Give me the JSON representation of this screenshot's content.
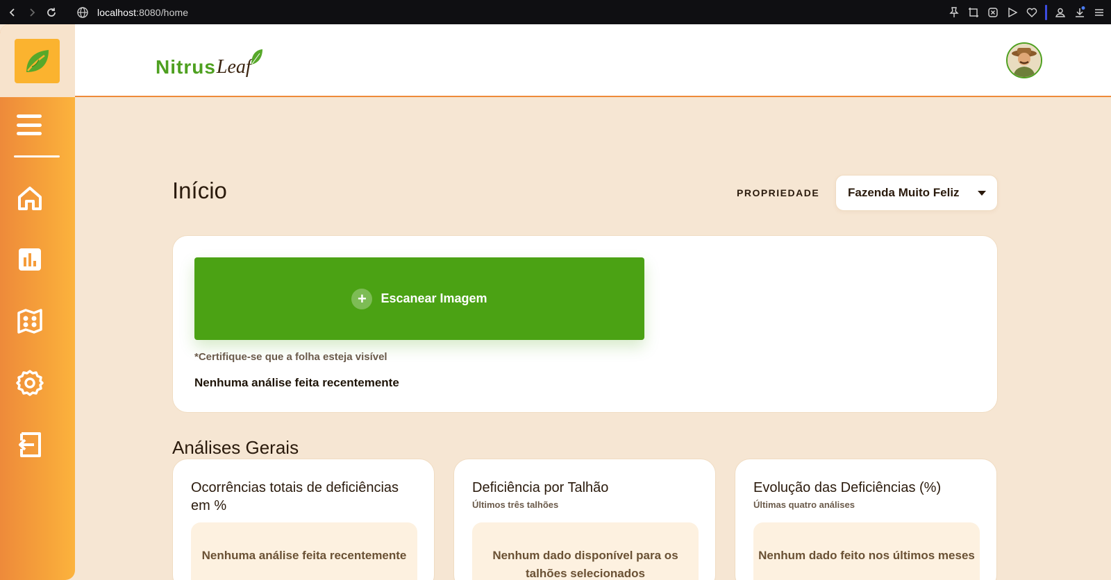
{
  "browser": {
    "url_host": "localhost",
    "url_rest": ":8080/home",
    "extension_icons": [
      "pin-icon",
      "screenshot-icon",
      "close-box-icon",
      "play-icon",
      "heart-icon",
      "profile-icon",
      "download-icon",
      "menu-icon"
    ]
  },
  "header": {
    "brand_part1": "Nitrus",
    "brand_part2": "Leaf",
    "avatar_icon": "farmer-avatar"
  },
  "sidebar": {
    "items": [
      {
        "name": "home",
        "icon": "home-icon"
      },
      {
        "name": "reports",
        "icon": "bar-chart-icon"
      },
      {
        "name": "map",
        "icon": "map-icon"
      },
      {
        "name": "settings",
        "icon": "gear-icon"
      },
      {
        "name": "logout",
        "icon": "logout-icon"
      }
    ],
    "colors": {
      "gradient_start": "#ee8a3a",
      "gradient_end": "#fcb33d"
    }
  },
  "main": {
    "title": "Início",
    "property_label": "PROPRIEDADE",
    "property_selected": "Fazenda Muito Feliz",
    "scan": {
      "button_label": "Escanear Imagem",
      "hint": "*Certifique-se que a folha esteja visível",
      "empty": "Nenhuma análise feita recentemente"
    },
    "section_title": "Análises Gerais",
    "cards": [
      {
        "title": "Ocorrências totais de deficiências em %",
        "subtitle": "",
        "empty": "Nenhuma análise feita recentemente"
      },
      {
        "title": "Deficiência por Talhão",
        "subtitle": "Últimos três talhões",
        "empty": "Nenhum dado disponível para os talhões selecionados"
      },
      {
        "title": "Evolução das Deficiências (%)",
        "subtitle": "Últimas quatro análises",
        "empty": "Nenhum dado feito nos últimos meses"
      }
    ]
  },
  "colors": {
    "accent_green": "#4ba214",
    "accent_orange": "#ee8a3a",
    "page_bg": "#f6e6d3"
  }
}
